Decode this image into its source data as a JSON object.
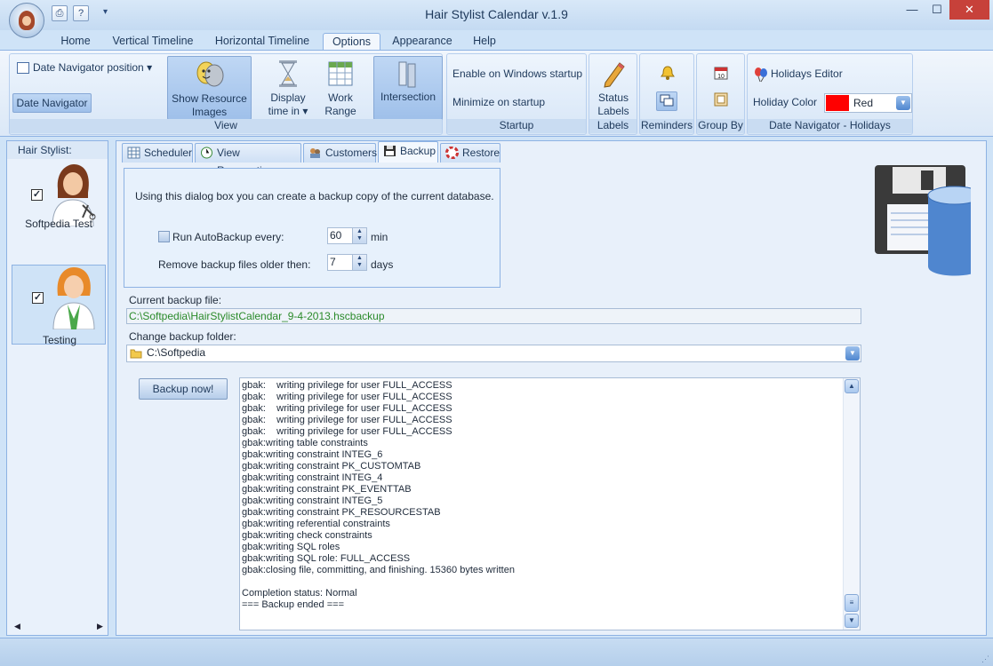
{
  "window": {
    "title": "Hair Stylist Calendar v.1.9",
    "controls": [
      "—",
      "☐",
      "✕"
    ]
  },
  "quick_access": {
    "qat_dropdown": "▾"
  },
  "ribbon_tabs": [
    "Home",
    "Vertical Timeline",
    "Horizontal Timeline",
    "Options",
    "Appearance",
    "Help"
  ],
  "active_ribbon_tab": "Options",
  "ribbon": {
    "view": {
      "label": "View",
      "date_navigator_position": "Date Navigator position",
      "date_navigator_position_arrow": "▾",
      "date_navigator": "Date Navigator",
      "show_resource_images_1": "Show Resource",
      "show_resource_images_2": "Images",
      "display_time_in_1": "Display",
      "display_time_in_2": "time in ▾",
      "work_range_1": "Work",
      "work_range_2": "Range",
      "intersection": "Intersection"
    },
    "startup": {
      "label": "Startup",
      "enable_windows_startup": "Enable on Windows startup",
      "minimize_on_startup": "Minimize on startup"
    },
    "labels": {
      "label": "Labels",
      "status_labels_1": "Status",
      "status_labels_2": "Labels"
    },
    "reminders": {
      "label": "Reminders"
    },
    "group_by": {
      "label": "Group By"
    },
    "holidays": {
      "label": "Date Navigator - Holidays",
      "holidays_editor": "Holidays Editor",
      "holiday_color_label": "Holiday Color",
      "holiday_color_value": "Red",
      "holiday_color_hex": "#ff0000"
    }
  },
  "left_panel": {
    "header": "Hair Stylist:",
    "stylists": [
      {
        "name": "Softpedia Test",
        "checked": "✓"
      },
      {
        "name": "Testing",
        "checked": "✓"
      }
    ]
  },
  "content_tabs": [
    "Scheduler",
    "View Reservations",
    "Customers",
    "Backup",
    "Restore"
  ],
  "active_content_tab": "Backup",
  "backup": {
    "description": "Using this dialog box you can create a backup copy of the current database.",
    "autobackup_label": "Run AutoBackup every:",
    "autobackup_value": "60",
    "autobackup_unit": "min",
    "remove_label": "Remove backup files older then:",
    "remove_value": "7",
    "remove_unit": "days",
    "current_file_label": "Current backup file:",
    "current_file_value": "C:\\Softpedia\\HairStylistCalendar_9-4-2013.hscbackup",
    "change_folder_label": "Change backup folder:",
    "folder_value": "C:\\Softpedia",
    "backup_button": "Backup now!"
  },
  "log_lines": [
    "gbak:    writing privilege for user FULL_ACCESS",
    "gbak:    writing privilege for user FULL_ACCESS",
    "gbak:    writing privilege for user FULL_ACCESS",
    "gbak:    writing privilege for user FULL_ACCESS",
    "gbak:    writing privilege for user FULL_ACCESS",
    "gbak:writing table constraints",
    "gbak:writing constraint INTEG_6",
    "gbak:writing constraint PK_CUSTOMTAB",
    "gbak:writing constraint INTEG_4",
    "gbak:writing constraint PK_EVENTTAB",
    "gbak:writing constraint INTEG_5",
    "gbak:writing constraint PK_RESOURCESTAB",
    "gbak:writing referential constraints",
    "gbak:writing check constraints",
    "gbak:writing SQL roles",
    "gbak:writing SQL role: FULL_ACCESS",
    "gbak:closing file, committing, and finishing. 15360 bytes written",
    "",
    "Completion status: Normal",
    "=== Backup ended ==="
  ],
  "colors": {
    "accent": "#8db2e3",
    "ribbon_bg": "#dbe8f7",
    "file_path_text": "#2a8a2a",
    "close_button": "#c7413a"
  }
}
